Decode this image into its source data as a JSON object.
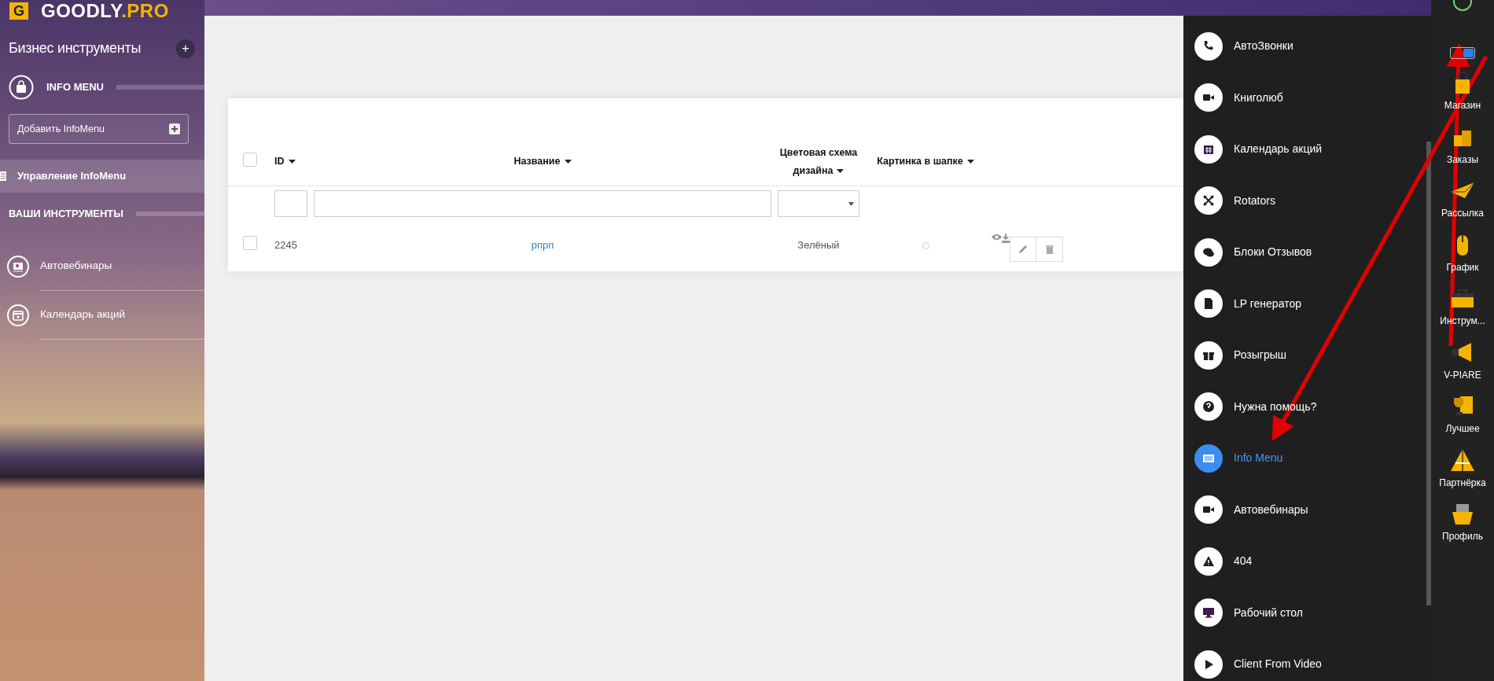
{
  "logo": {
    "mark": "G",
    "name": "GOODLY",
    "suffix": ".PRO"
  },
  "sidebar": {
    "title": "Бизнес инструменты",
    "add_icon": "+",
    "section": "INFO MENU",
    "add_button": "Добавить InfoMenu",
    "items": [
      {
        "label": "Управление InfoMenu",
        "selected": true
      }
    ],
    "tools_heading": "ВАШИ ИНСТРУМЕНТЫ",
    "tools": [
      {
        "label": "Автовебинары"
      },
      {
        "label": "Календарь акций"
      }
    ]
  },
  "table": {
    "select_all": {
      "checked": false
    },
    "columns": [
      {
        "label": "ID",
        "sortable": true
      },
      {
        "label": "Название",
        "sortable": true
      },
      {
        "label": "Цветовая схема дизайна",
        "sortable": true
      },
      {
        "label": "Картинка в шапке",
        "sortable": true
      }
    ],
    "filters": [
      {
        "kind": "text"
      },
      {
        "kind": "text"
      },
      {
        "kind": "select"
      }
    ],
    "rows": [
      {
        "checked": false,
        "id": "2245",
        "name": "рпрп",
        "color_scheme": "Зелёный",
        "header_image": false
      }
    ]
  },
  "menu": {
    "items": [
      {
        "label": "АвтоЗвонки",
        "selected": false
      },
      {
        "label": "Книголюб",
        "selected": false
      },
      {
        "label": "Календарь акций",
        "selected": false
      },
      {
        "label": "Rotators",
        "selected": false
      },
      {
        "label": "Блоки Отзывов",
        "selected": false
      },
      {
        "label": "LP генератор",
        "selected": false
      },
      {
        "label": "Розыгрыш",
        "selected": false
      },
      {
        "label": "Нужна помощь?",
        "selected": false
      },
      {
        "label": "Info Menu",
        "selected": true
      },
      {
        "label": "Автовебинары",
        "selected": false
      },
      {
        "label": "404",
        "selected": false
      },
      {
        "label": "Рабочий стол",
        "selected": false
      },
      {
        "label": "Client From Video",
        "selected": false
      }
    ]
  },
  "dock": {
    "toggle": {
      "on": true
    },
    "items": [
      {
        "label": "Магазин"
      },
      {
        "label": "Заказы"
      },
      {
        "label": "Рассылка"
      },
      {
        "label": "График"
      },
      {
        "label": "Инструм..."
      },
      {
        "label": "V-PIARE"
      },
      {
        "label": "Лучшее"
      },
      {
        "label": "Партнёрка"
      },
      {
        "label": "Профиль"
      }
    ]
  }
}
